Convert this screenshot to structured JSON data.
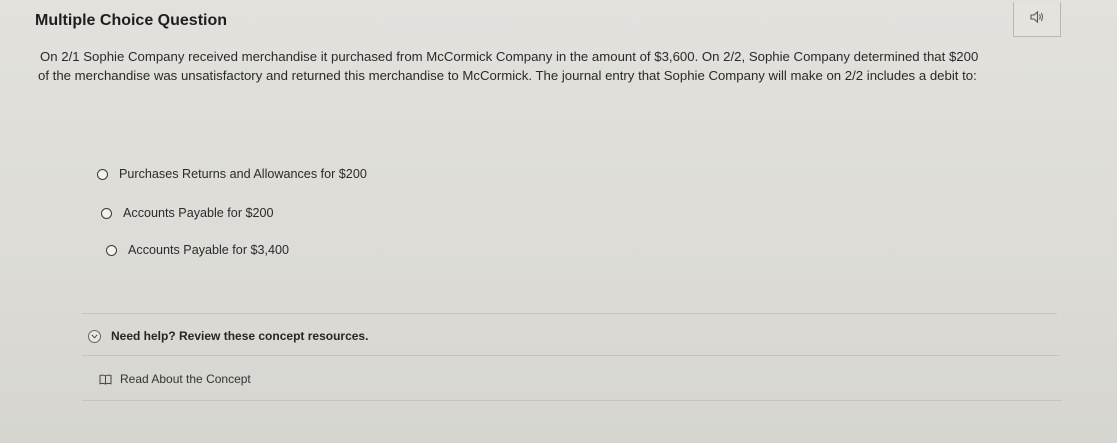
{
  "header": {
    "title": "Multiple Choice Question",
    "audio_icon": "speaker-icon"
  },
  "question": {
    "line1": "On 2/1 Sophie Company received merchandise it purchased from McCormick Company in the amount of $3,600.  On 2/2, Sophie Company determined that $200",
    "line2": "of the merchandise was unsatisfactory and returned this merchandise to McCormick. The journal entry that Sophie Company will make on 2/2 includes a debit to:"
  },
  "options": [
    {
      "label": "Purchases Returns and Allowances for $200"
    },
    {
      "label": "Accounts Payable for $200"
    },
    {
      "label": "Accounts Payable for $3,400"
    }
  ],
  "help": {
    "label": "Need help? Review these concept resources.",
    "icon": "chevron-down-icon"
  },
  "resources": [
    {
      "label": "Read About the Concept",
      "icon": "book-icon"
    }
  ],
  "colors": {
    "background": "#dddcd6",
    "text": "#222222",
    "divider": "#c5c4be"
  }
}
